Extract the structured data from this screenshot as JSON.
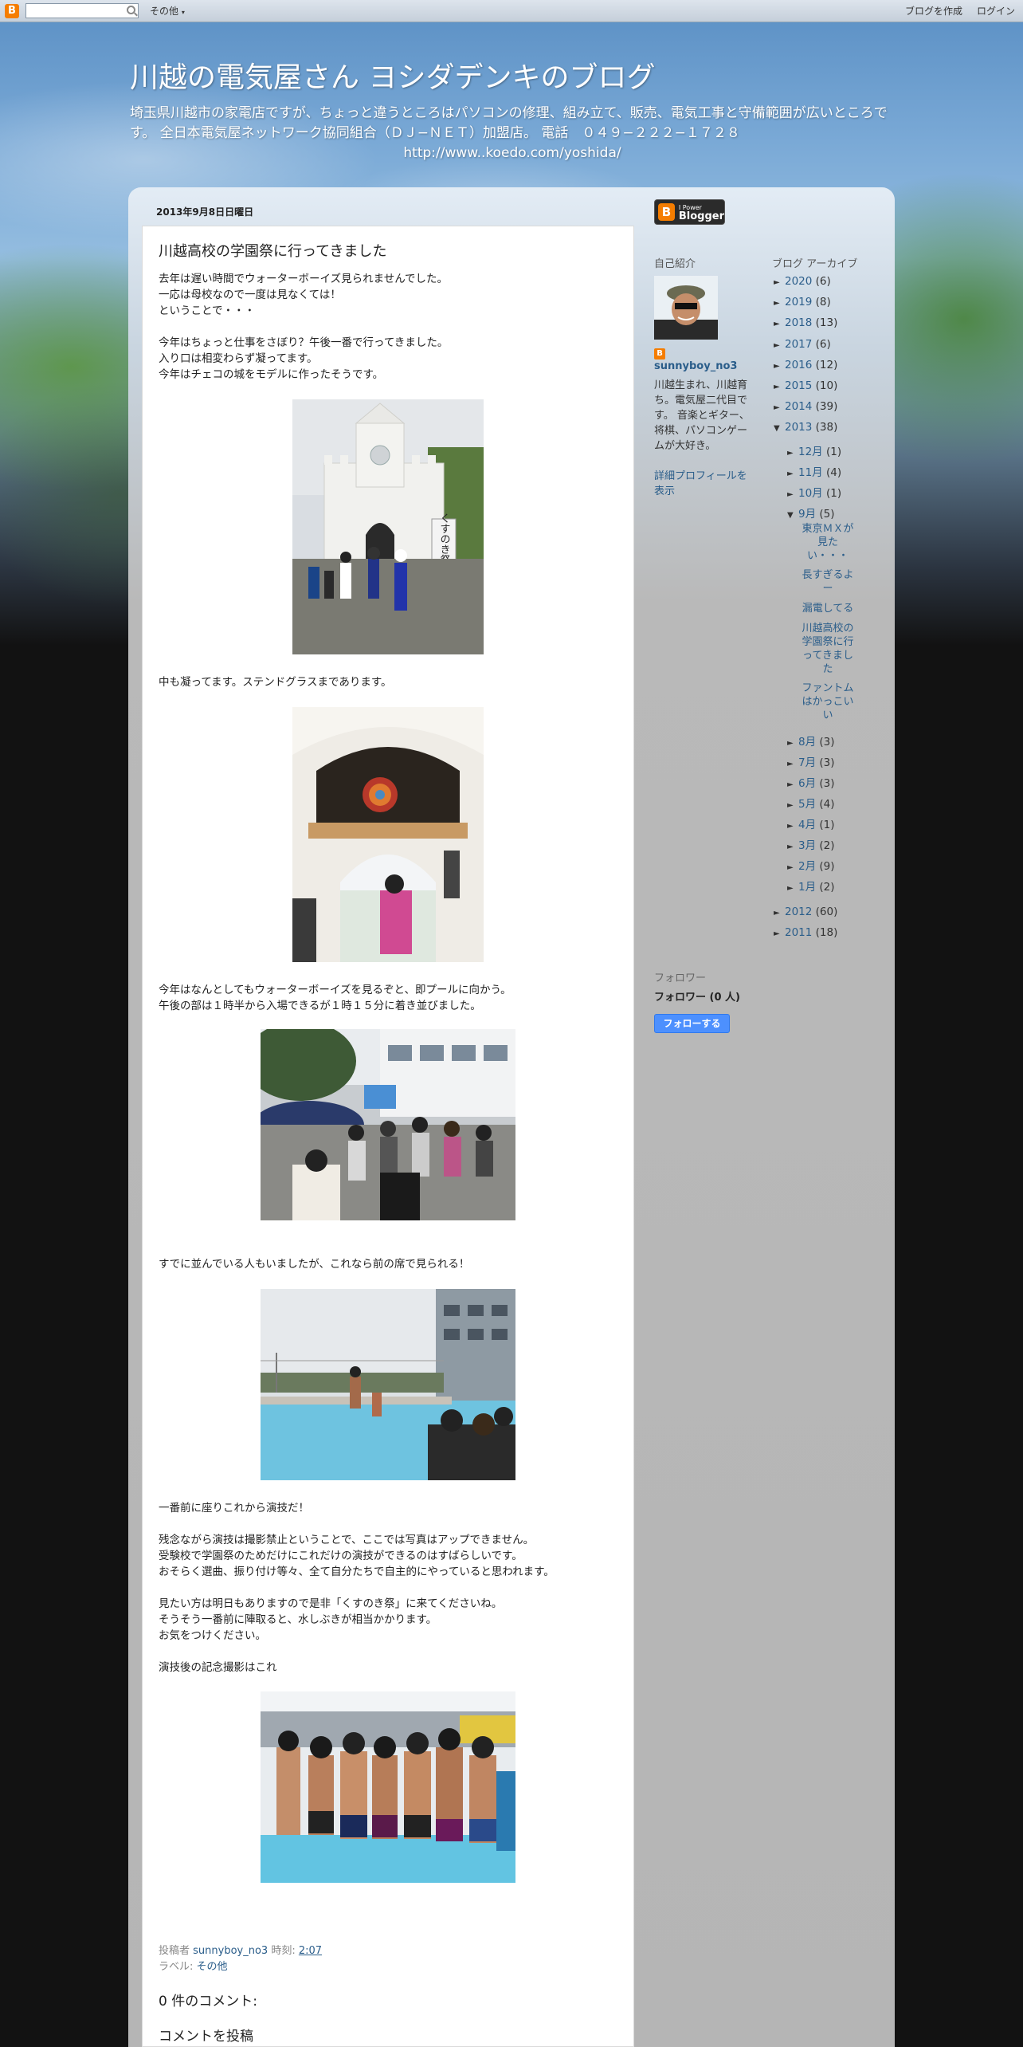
{
  "navbar": {
    "more_label": "その他",
    "create_blog": "ブログを作成",
    "login": "ログイン"
  },
  "header": {
    "title": "川越の電気屋さん ヨシダデンキのブログ",
    "description": "埼玉県川越市の家電店ですが、ちょっと違うところはパソコンの修理、組み立て、販売、電気工事と守備範囲が広いところです。 全日本電気屋ネットワーク協同組合（ＤＪ−ＮＥＴ）加盟店。 電話　０４９−２２２−１７２８",
    "url": "http://www..koedo.com/yoshida/"
  },
  "post": {
    "date": "2013年9月8日日曜日",
    "title": "川越高校の学園祭に行ってきました",
    "paragraphs": [
      [
        "去年は遅い時間でウォーターボーイズ見られませんでした。",
        "一応は母校なので一度は見なくては！",
        "ということで・・・"
      ],
      [
        "今年はちょっと仕事をさぼり？午後一番で行ってきました。",
        "入り口は相変わらず凝ってます。",
        "今年はチェコの城をモデルに作ったそうです。"
      ],
      [
        "中も凝ってます。ステンドグラスまであります。"
      ],
      [
        "今年はなんとしてもウォーターボーイズを見るぞと、即プールに向かう。",
        "午後の部は１時半から入場できるが１時１５分に着き並びました。"
      ],
      [
        "すでに並んでいる人もいましたが、これなら前の席で見られる！"
      ],
      [
        "一番前に座りこれから演技だ！"
      ],
      [
        "残念ながら演技は撮影禁止ということで、ここでは写真はアップできません。",
        "受験校で学園祭のためだけにこれだけの演技ができるのはすばらしいです。",
        "おそらく選曲、振り付け等々、全て自分たちで自主的にやっていると思われます。"
      ],
      [
        "見たい方は明日もありますので是非「くすのき祭」に来てくださいね。",
        "そうそう一番前に陣取ると、水しぶきが相当かかります。",
        "お気をつけください。"
      ],
      [
        "演技後の記念撮影はこれ"
      ]
    ],
    "banner_text": "くすのき祭",
    "footer": {
      "posted_by_label": "投稿者",
      "author": "sunnyboy_no3",
      "time_label": "時刻:",
      "time": "2:07",
      "labels_label": "ラベル:",
      "label": "その他"
    },
    "comments_count": "0 件のコメント:",
    "post_comment": "コメントを投稿"
  },
  "sidebar": {
    "blogger_badge": {
      "small": "I Power",
      "big": "Blogger"
    },
    "profile": {
      "heading": "自己紹介",
      "name": "sunnyboy_no3",
      "description": "川越生まれ、川越育ち。電気屋二代目です。 音楽とギター、将棋、パソコンゲームが大好き。",
      "more": "詳細プロフィールを表示"
    },
    "archive": {
      "heading": "ブログ アーカイブ",
      "years_top": [
        {
          "year": "2020",
          "count": "(6)"
        },
        {
          "year": "2019",
          "count": "(8)"
        },
        {
          "year": "2018",
          "count": "(13)"
        },
        {
          "year": "2017",
          "count": "(6)"
        },
        {
          "year": "2016",
          "count": "(12)"
        },
        {
          "year": "2015",
          "count": "(10)"
        },
        {
          "year": "2014",
          "count": "(39)"
        },
        {
          "year": "2013",
          "count": "(38)"
        }
      ],
      "months_top": [
        {
          "month": "12月",
          "count": "(1)"
        },
        {
          "month": "11月",
          "count": "(4)"
        },
        {
          "month": "10月",
          "count": "(1)"
        },
        {
          "month": "9月",
          "count": "(5)"
        }
      ],
      "posts": [
        "東京ＭＸが見たい・・・",
        "長すぎるよー",
        "漏電してる",
        "川越高校の学園祭に行ってきました",
        "ファントムはかっこいい"
      ],
      "months_bottom": [
        {
          "month": "8月",
          "count": "(3)"
        },
        {
          "month": "7月",
          "count": "(3)"
        },
        {
          "month": "6月",
          "count": "(3)"
        },
        {
          "month": "5月",
          "count": "(4)"
        },
        {
          "month": "4月",
          "count": "(1)"
        },
        {
          "month": "3月",
          "count": "(2)"
        },
        {
          "month": "2月",
          "count": "(9)"
        },
        {
          "month": "1月",
          "count": "(2)"
        }
      ],
      "years_bottom": [
        {
          "year": "2012",
          "count": "(60)"
        },
        {
          "year": "2011",
          "count": "(18)"
        }
      ],
      "expanded_marker": "▼",
      "collapsed_marker": "►"
    },
    "followers": {
      "heading": "フォロワー",
      "count": "フォロワー (0 人)",
      "button": "フォローする"
    }
  }
}
